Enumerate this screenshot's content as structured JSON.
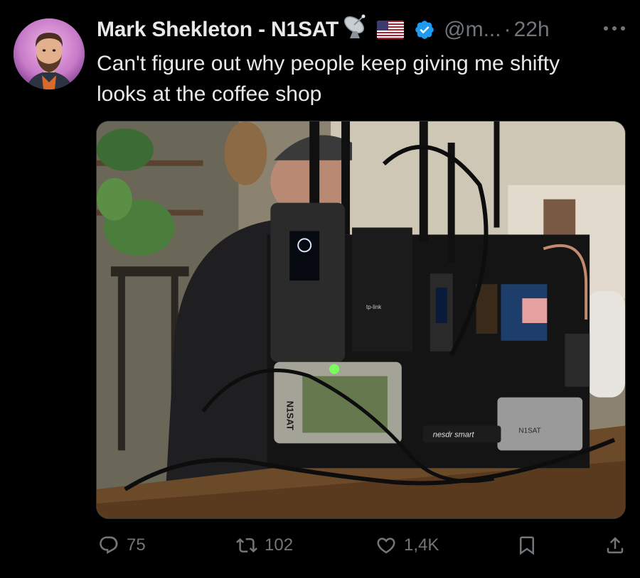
{
  "author": {
    "display_name": "Mark Shekleton - N1SAT",
    "name_emoji": "satellite-antenna",
    "flag": "us-flag",
    "verified": true,
    "handle": "@m...",
    "separator": "·",
    "time": "22h"
  },
  "tweet": {
    "text": "Can't figure out why people keep giving me shifty looks at the coffee shop"
  },
  "media": {
    "labels": {
      "n1sat_vertical": "N1SAT",
      "n1sat_case": "N1SAT",
      "sdr_brand": "nesdr smart",
      "router_brand": "tp-link"
    }
  },
  "actions": {
    "replies": "75",
    "reposts": "102",
    "likes": "1,4K"
  },
  "colors": {
    "background": "#000000",
    "text_primary": "#e7e9ea",
    "text_secondary": "#71767b",
    "verified_blue": "#1d9bf0"
  }
}
